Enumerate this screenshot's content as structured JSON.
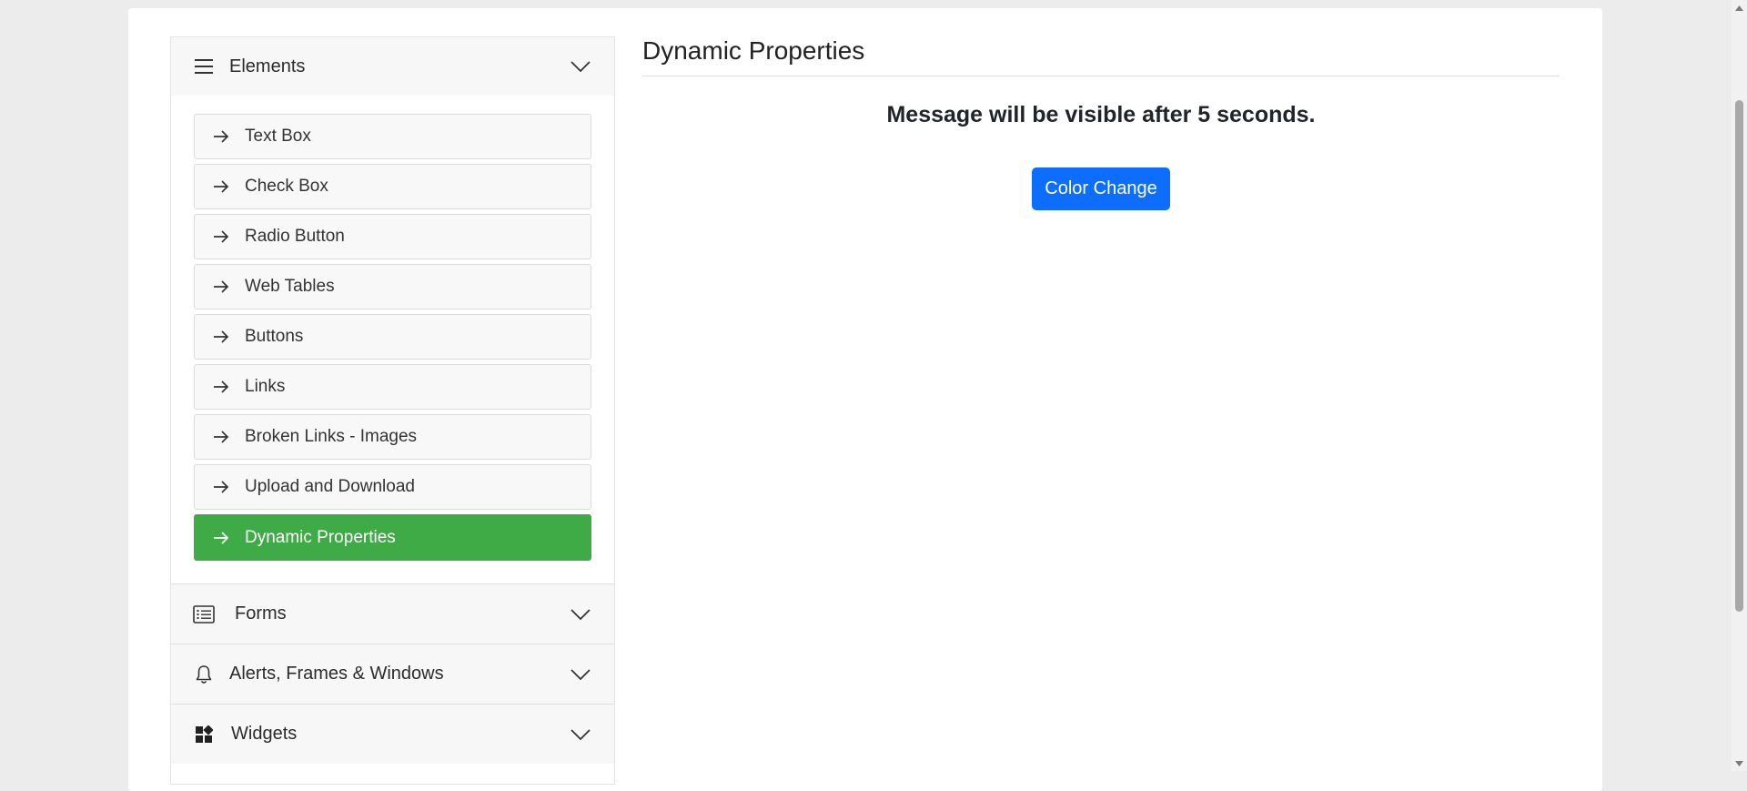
{
  "sidebar": {
    "elements_group": {
      "label": "Elements",
      "icon": "hamburger-icon",
      "expanded": true,
      "items": [
        {
          "label": "Text Box"
        },
        {
          "label": "Check Box"
        },
        {
          "label": "Radio Button"
        },
        {
          "label": "Web Tables"
        },
        {
          "label": "Buttons"
        },
        {
          "label": "Links"
        },
        {
          "label": "Broken Links - Images"
        },
        {
          "label": "Upload and Download"
        },
        {
          "label": "Dynamic Properties",
          "active": true
        }
      ]
    },
    "other_groups": [
      {
        "label": "Forms",
        "icon": "list-icon"
      },
      {
        "label": "Alerts, Frames & Windows",
        "icon": "bell-icon"
      },
      {
        "label": "Widgets",
        "icon": "widgets-icon"
      }
    ]
  },
  "main": {
    "title": "Dynamic Properties",
    "message": "Message will be visible after 5 seconds.",
    "color_change_button": "Color Change"
  },
  "colors": {
    "active_item": "#3fab47",
    "primary_button": "#0d6efd"
  }
}
